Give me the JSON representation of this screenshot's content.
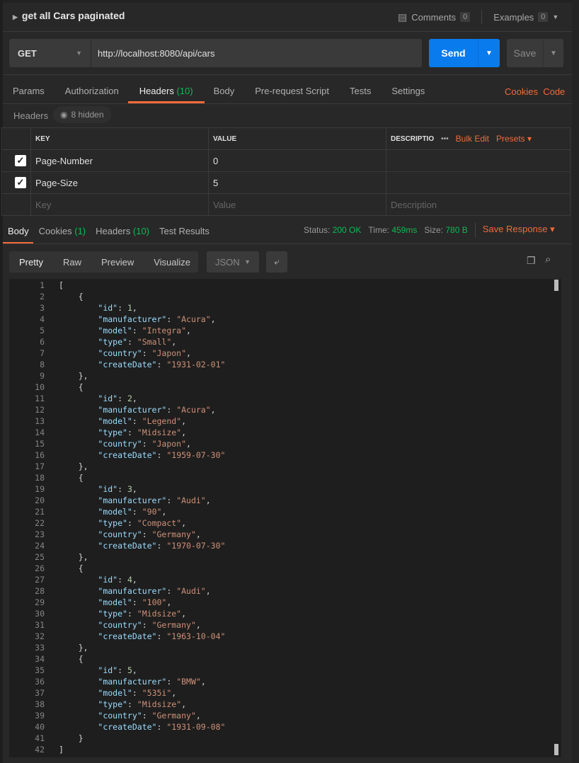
{
  "request": {
    "title": "get all Cars paginated",
    "method": "GET",
    "url": "http://localhost:8080/api/cars",
    "send_label": "Send",
    "save_label": "Save"
  },
  "header_actions": {
    "comments_label": "Comments",
    "comments_count": "0",
    "examples_label": "Examples",
    "examples_count": "0"
  },
  "request_tabs": [
    {
      "label": "Params"
    },
    {
      "label": "Authorization"
    },
    {
      "label": "Headers",
      "count": "(10)",
      "active": true
    },
    {
      "label": "Body"
    },
    {
      "label": "Pre-request Script"
    },
    {
      "label": "Tests"
    },
    {
      "label": "Settings"
    }
  ],
  "request_links": {
    "cookies": "Cookies",
    "code": "Code"
  },
  "headers_section": {
    "label": "Headers",
    "hidden": "8 hidden",
    "columns": {
      "key": "KEY",
      "value": "VALUE",
      "description": "DESCRIPTIO",
      "bulk_edit": "Bulk Edit",
      "presets": "Presets"
    },
    "rows": [
      {
        "key": "Page-Number",
        "value": "0",
        "checked": true
      },
      {
        "key": "Page-Size",
        "value": "5",
        "checked": true
      }
    ],
    "placeholders": {
      "key": "Key",
      "value": "Value",
      "description": "Description"
    }
  },
  "response_tabs": [
    {
      "label": "Body",
      "active": true
    },
    {
      "label": "Cookies",
      "count": "(1)"
    },
    {
      "label": "Headers",
      "count": "(10)"
    },
    {
      "label": "Test Results"
    }
  ],
  "response_status": {
    "status_label": "Status:",
    "status": "200 OK",
    "time_label": "Time:",
    "time": "459ms",
    "size_label": "Size:",
    "size": "780 B",
    "save_response": "Save Response"
  },
  "view_modes": [
    {
      "label": "Pretty",
      "active": true
    },
    {
      "label": "Raw"
    },
    {
      "label": "Preview"
    },
    {
      "label": "Visualize"
    }
  ],
  "format": "JSON",
  "colors": {
    "accent": "#f26b3a",
    "send": "#097bed",
    "success": "#0cbb52",
    "json_key": "#9cdcfe",
    "json_string": "#ce9178",
    "json_number": "#b5cea8"
  },
  "response_body": [
    {
      "id": 1,
      "manufacturer": "Acura",
      "model": "Integra",
      "type": "Small",
      "country": "Japon",
      "createDate": "1931-02-01"
    },
    {
      "id": 2,
      "manufacturer": "Acura",
      "model": "Legend",
      "type": "Midsize",
      "country": "Japon",
      "createDate": "1959-07-30"
    },
    {
      "id": 3,
      "manufacturer": "Audi",
      "model": "90",
      "type": "Compact",
      "country": "Germany",
      "createDate": "1970-07-30"
    },
    {
      "id": 4,
      "manufacturer": "Audi",
      "model": "100",
      "type": "Midsize",
      "country": "Germany",
      "createDate": "1963-10-04"
    },
    {
      "id": 5,
      "manufacturer": "BMW",
      "model": "535i",
      "type": "Midsize",
      "country": "Germany",
      "createDate": "1931-09-08"
    }
  ]
}
